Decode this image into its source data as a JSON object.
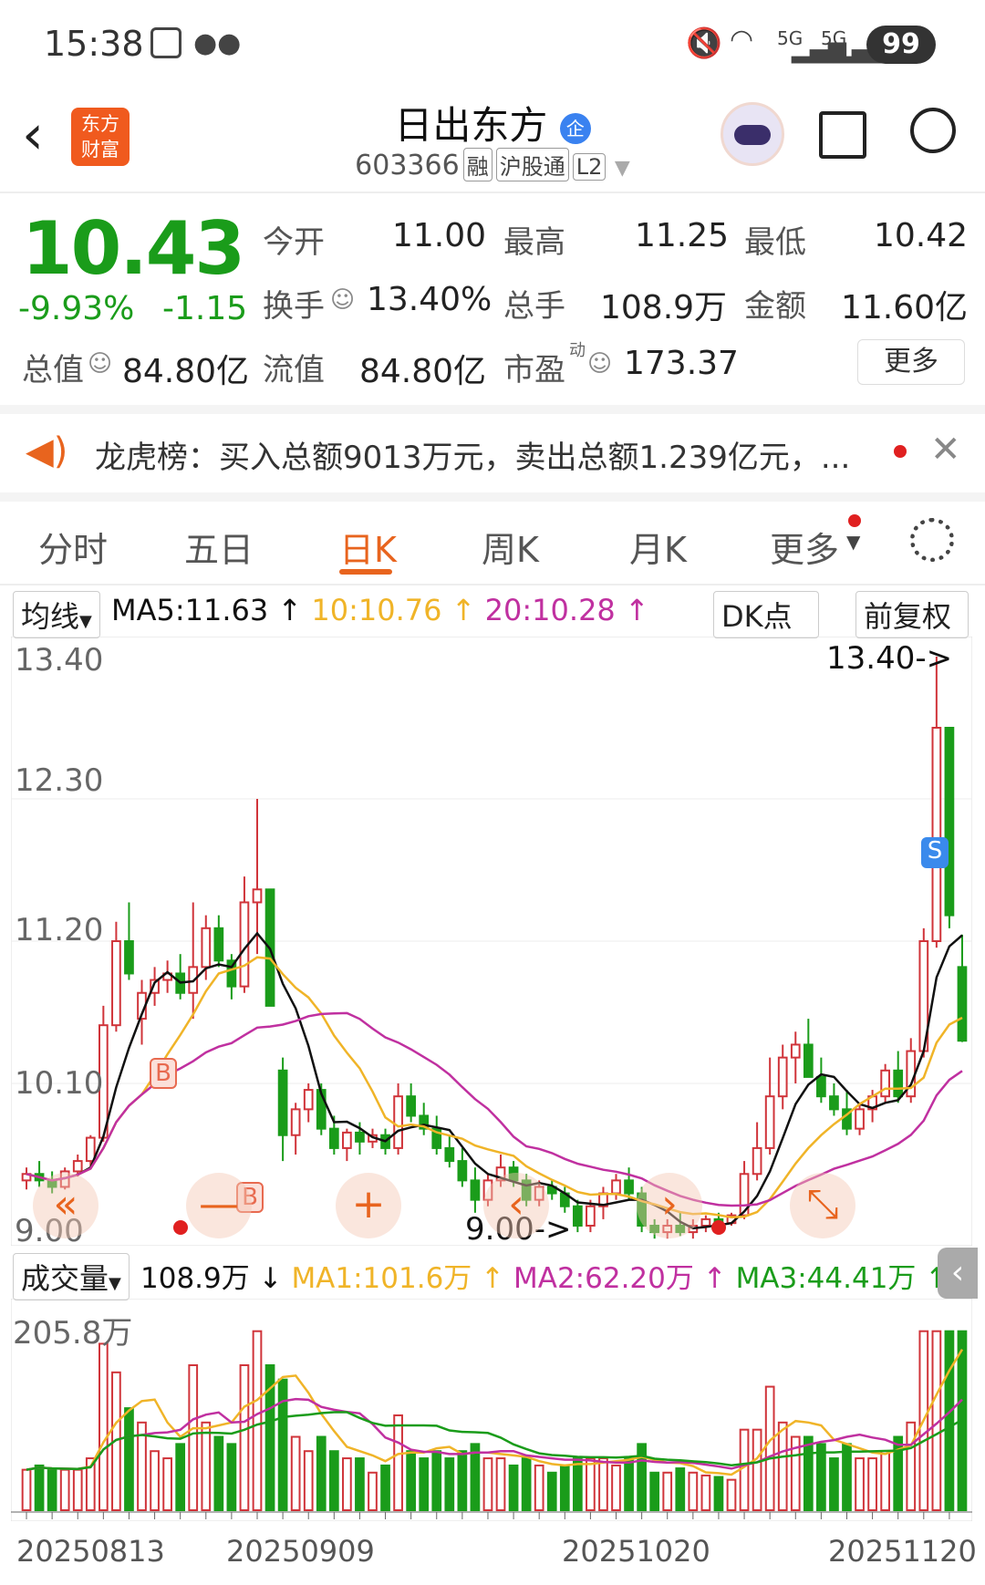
{
  "status_bar": {
    "time": "15:38",
    "battery": "99",
    "net1": "5G",
    "net2": "5G"
  },
  "header": {
    "logo_line1": "东方",
    "logo_line2": "财富",
    "title": "日出东方",
    "enterprise_badge": "企",
    "code": "603366",
    "tags": [
      "融",
      "沪股通",
      "L2"
    ]
  },
  "quote": {
    "price": "10.43",
    "change_pct": "-9.93%",
    "change_abs": "-1.15",
    "fields": [
      {
        "label": "今开",
        "value": "11.00"
      },
      {
        "label": "最高",
        "value": "11.25"
      },
      {
        "label": "最低",
        "value": "10.42"
      },
      {
        "label": "换手",
        "value": "13.40%"
      },
      {
        "label": "总手",
        "value": "108.9万"
      },
      {
        "label": "金额",
        "value": "11.60亿"
      },
      {
        "label": "总值",
        "value": "84.80亿"
      },
      {
        "label": "流值",
        "value": "84.80亿"
      },
      {
        "label": "市盈",
        "value": "173.37"
      }
    ],
    "pe_sup": "动",
    "more_button": "更多"
  },
  "banner": {
    "text": "龙虎榜：买入总额9013万元，卖出总额1.239亿元，..."
  },
  "tabs": [
    "分时",
    "五日",
    "日K",
    "周K",
    "月K",
    "更多"
  ],
  "active_tab": "日K",
  "chart_toolbar": {
    "ma_selector": "均线",
    "ma5": "MA5:11.63",
    "ma10": "10:10.76",
    "ma20": "20:10.28",
    "dk_button": "DK点",
    "adjust_button": "前复权"
  },
  "colors": {
    "up": "#d0343a",
    "down": "#1a9c1a",
    "ma5": "#111111",
    "ma10": "#f0b428",
    "ma20": "#c030a0",
    "accent": "#e8641e"
  },
  "chart_data": [
    {
      "type": "candlestick",
      "y_ticks": [
        "13.40",
        "12.30",
        "11.20",
        "10.10",
        "9.00"
      ],
      "ylim": [
        9.0,
        13.4
      ],
      "annotations": [
        "13.40->",
        "9.00->"
      ],
      "markers": [
        "B",
        "B",
        "S"
      ],
      "candles": [
        [
          9.35,
          9.45,
          9.28,
          9.4
        ],
        [
          9.4,
          9.5,
          9.3,
          9.35
        ],
        [
          9.35,
          9.42,
          9.25,
          9.3
        ],
        [
          9.3,
          9.45,
          9.28,
          9.42
        ],
        [
          9.42,
          9.55,
          9.38,
          9.5
        ],
        [
          9.5,
          9.7,
          9.45,
          9.68
        ],
        [
          9.68,
          10.7,
          9.65,
          10.55
        ],
        [
          10.55,
          11.35,
          10.5,
          11.2
        ],
        [
          11.2,
          11.5,
          10.9,
          10.95
        ],
        [
          10.6,
          10.9,
          10.4,
          10.8
        ],
        [
          10.8,
          11.0,
          10.7,
          10.9
        ],
        [
          10.9,
          11.05,
          10.8,
          10.95
        ],
        [
          10.95,
          11.1,
          10.75,
          10.8
        ],
        [
          10.8,
          11.5,
          10.6,
          11.0
        ],
        [
          11.0,
          11.4,
          10.9,
          11.3
        ],
        [
          11.3,
          11.4,
          11.0,
          11.05
        ],
        [
          11.05,
          11.1,
          10.75,
          10.85
        ],
        [
          10.85,
          11.7,
          10.8,
          11.5
        ],
        [
          11.5,
          12.3,
          11.1,
          11.6
        ],
        [
          11.6,
          11.6,
          10.7,
          10.7
        ],
        [
          10.2,
          10.3,
          9.5,
          9.7
        ],
        [
          9.7,
          9.95,
          9.55,
          9.9
        ],
        [
          9.9,
          10.1,
          9.8,
          10.05
        ],
        [
          10.05,
          10.1,
          9.7,
          9.75
        ],
        [
          9.75,
          9.85,
          9.55,
          9.6
        ],
        [
          9.6,
          9.75,
          9.5,
          9.72
        ],
        [
          9.72,
          9.8,
          9.55,
          9.65
        ],
        [
          9.65,
          9.75,
          9.6,
          9.7
        ],
        [
          9.7,
          9.75,
          9.55,
          9.6
        ],
        [
          9.6,
          10.1,
          9.55,
          10.0
        ],
        [
          10.0,
          10.1,
          9.8,
          9.85
        ],
        [
          9.85,
          9.95,
          9.7,
          9.75
        ],
        [
          9.75,
          9.85,
          9.55,
          9.6
        ],
        [
          9.6,
          9.7,
          9.45,
          9.5
        ],
        [
          9.5,
          9.6,
          9.3,
          9.35
        ],
        [
          9.35,
          9.45,
          9.1,
          9.2
        ],
        [
          9.2,
          9.4,
          9.15,
          9.35
        ],
        [
          9.35,
          9.55,
          9.3,
          9.45
        ],
        [
          9.45,
          9.5,
          9.3,
          9.35
        ],
        [
          9.35,
          9.4,
          9.15,
          9.2
        ],
        [
          9.2,
          9.35,
          9.15,
          9.3
        ],
        [
          9.3,
          9.35,
          9.2,
          9.25
        ],
        [
          9.25,
          9.3,
          9.1,
          9.15
        ],
        [
          9.15,
          9.2,
          8.95,
          9.0
        ],
        [
          9.0,
          9.2,
          8.95,
          9.15
        ],
        [
          9.15,
          9.3,
          9.05,
          9.25
        ],
        [
          9.25,
          9.4,
          9.2,
          9.35
        ],
        [
          9.35,
          9.45,
          9.2,
          9.25
        ],
        [
          9.25,
          9.3,
          8.95,
          9.0
        ],
        [
          9.0,
          9.05,
          8.9,
          8.95
        ],
        [
          8.95,
          9.05,
          8.9,
          9.0
        ],
        [
          9.0,
          9.1,
          8.92,
          8.95
        ],
        [
          8.95,
          9.05,
          8.9,
          9.0
        ],
        [
          9.0,
          9.08,
          8.95,
          9.05
        ],
        [
          9.05,
          9.1,
          8.98,
          9.02
        ],
        [
          9.02,
          9.1,
          9.0,
          9.08
        ],
        [
          9.08,
          9.5,
          9.05,
          9.4
        ],
        [
          9.4,
          9.8,
          9.35,
          9.6
        ],
        [
          9.6,
          10.3,
          9.55,
          10.0
        ],
        [
          10.0,
          10.4,
          9.9,
          10.3
        ],
        [
          10.3,
          10.5,
          10.1,
          10.4
        ],
        [
          10.4,
          10.6,
          10.2,
          10.15
        ],
        [
          10.15,
          10.3,
          9.95,
          10.0
        ],
        [
          10.0,
          10.1,
          9.85,
          9.9
        ],
        [
          9.9,
          10.05,
          9.7,
          9.75
        ],
        [
          9.75,
          9.95,
          9.7,
          9.9
        ],
        [
          9.9,
          10.05,
          9.8,
          10.0
        ],
        [
          10.0,
          10.25,
          9.95,
          10.2
        ],
        [
          10.2,
          10.35,
          9.95,
          10.0
        ],
        [
          10.0,
          10.45,
          9.95,
          10.35
        ],
        [
          10.35,
          11.3,
          10.3,
          11.2
        ],
        [
          11.2,
          13.4,
          11.15,
          12.85
        ],
        [
          12.85,
          12.85,
          11.3,
          11.4
        ],
        [
          11.0,
          11.25,
          10.42,
          10.43
        ]
      ]
    },
    {
      "type": "bar",
      "series_labels": {
        "selector": "成交量",
        "vol": "108.9万",
        "ma1": "MA1:101.6万",
        "ma2": "MA2:62.20万",
        "ma3": "MA3:44.41万"
      },
      "y_ticks": [
        "205.8万"
      ],
      "ylim": [
        0,
        205.8
      ],
      "x_ticks": [
        "20250813",
        "20250909",
        "20251020",
        "20251120"
      ]
    }
  ]
}
